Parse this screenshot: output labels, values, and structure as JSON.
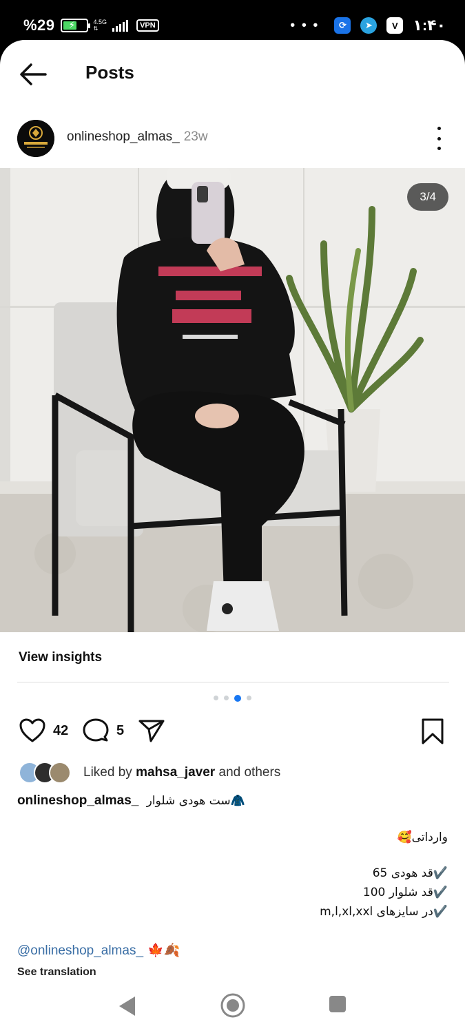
{
  "status_bar": {
    "battery_percent": "%29",
    "network_type": "4.5G",
    "vpn_label": "VPN",
    "overflow_dots": "• • •",
    "time": "۱:۴۰",
    "app_icon_v": "V"
  },
  "header": {
    "title": "Posts",
    "back_icon": "arrow-left-icon"
  },
  "post": {
    "username": "onlineshop_almas_",
    "time_ago": "23w",
    "image_counter": "3/4",
    "image_index": 3,
    "image_total": 4,
    "view_insights": "View insights",
    "likes_count": "42",
    "comments_count": "5",
    "liked_by_prefix": "Liked by",
    "liked_by_user": "mahsa_javer",
    "liked_by_suffix": "and others",
    "caption_username": "onlineshop_almas_",
    "caption_first_line": "ست هودی شلوار🧥",
    "caption_lines": [
      "وارداتی🥰",
      "✔️قد هودی 65",
      "✔️قد شلوار 100",
      "✔️در سایزهای m,l,xl,xxl"
    ],
    "mention": "@onlineshop_almas_",
    "mention_emoji": "🍁🍂",
    "see_translation": "See translation"
  },
  "colors": {
    "accent_blue": "#1877f2",
    "link_blue": "#3a6ea5",
    "background": "#ffffff"
  }
}
